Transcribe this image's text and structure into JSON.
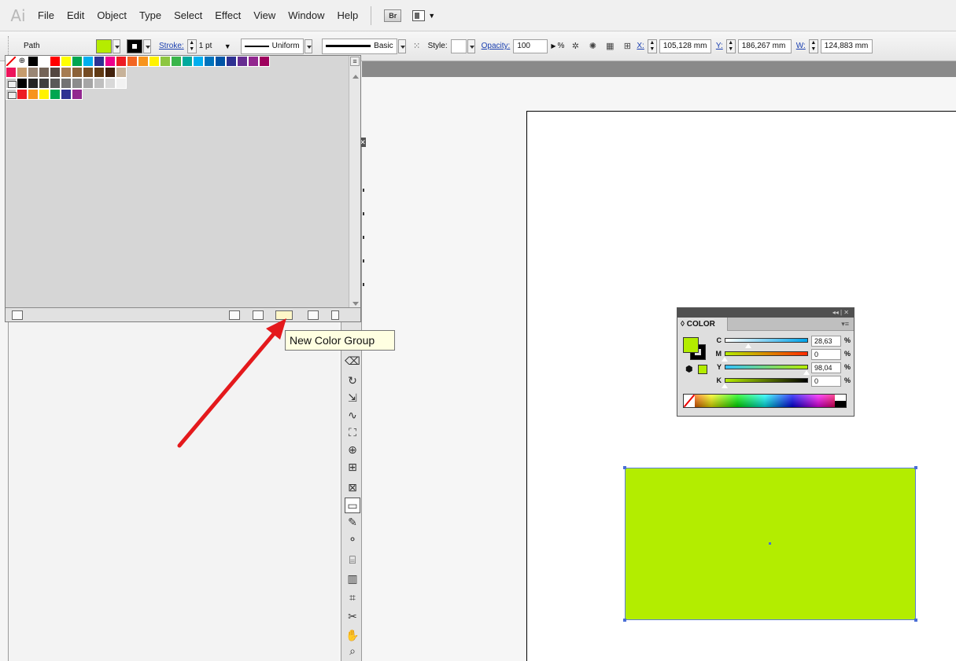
{
  "app": {
    "logo": "Ai"
  },
  "menu": [
    "File",
    "Edit",
    "Object",
    "Type",
    "Select",
    "Effect",
    "View",
    "Window",
    "Help"
  ],
  "menu_extras": {
    "bridge_label": "Br"
  },
  "control_bar": {
    "selection_type": "Path",
    "fill_color": "#b5ec00",
    "stroke_label": "Stroke:",
    "stroke_weight": "1 pt",
    "profile_label": "Uniform",
    "brush_label": "Basic",
    "style_label": "Style:",
    "opacity_label": "Opacity:",
    "opacity_value": "100",
    "opacity_unit": "%",
    "x_label": "X:",
    "x_value": "105,128 mm",
    "y_label": "Y:",
    "y_value": "186,267 mm",
    "w_label": "W:",
    "w_value": "124,883 mm"
  },
  "swatches": {
    "row1": [
      "#000000",
      "#ffffff",
      "#ff0000",
      "#ffff00",
      "#00a651",
      "#00aeef",
      "#2e3192",
      "#ec008c",
      "#ed1c24",
      "#f26522",
      "#f7941d",
      "#fff200",
      "#8dc63f",
      "#39b54a",
      "#00a99d",
      "#00aeef",
      "#0072bc",
      "#0054a6",
      "#2e3192",
      "#662d91",
      "#92278f",
      "#9e005d"
    ],
    "row2": [
      "#ed145b",
      "#c69c6d",
      "#998675",
      "#736357",
      "#534741",
      "#a67c52",
      "#8c6239",
      "#754c24",
      "#603913",
      "#42210b",
      "#c7b299"
    ],
    "row3": [
      "#000000",
      "#252525",
      "#404040",
      "#595959",
      "#737373",
      "#8c8c8c",
      "#a6a6a6",
      "#bfbfbf",
      "#d9d9d9",
      "#f2f2f2"
    ],
    "row4": [
      "#ed1c24",
      "#f7941d",
      "#fff200",
      "#00a651",
      "#2e3192",
      "#92278f"
    ]
  },
  "tooltip": {
    "text": "New Color Group"
  },
  "color_panel": {
    "title": "COLOR",
    "fill_color": "#b3ed00",
    "channels": [
      {
        "label": "C",
        "value": "28,63",
        "unit": "%",
        "level": 28.63,
        "gradient": "linear-gradient(90deg,#ffffff,#00a2e8)"
      },
      {
        "label": "M",
        "value": "0",
        "unit": "%",
        "level": 0,
        "gradient": "linear-gradient(90deg,#b5ec00,#ff2a00)"
      },
      {
        "label": "Y",
        "value": "98,04",
        "unit": "%",
        "level": 98.04,
        "gradient": "linear-gradient(90deg,#33c2ff,#b5ec00)"
      },
      {
        "label": "K",
        "value": "0",
        "unit": "%",
        "level": 0,
        "gradient": "linear-gradient(90deg,#b5ec00,#000000)"
      }
    ]
  },
  "canvas": {
    "rect_color": "#b3ed00",
    "selection_color": "#4a6fd6"
  }
}
